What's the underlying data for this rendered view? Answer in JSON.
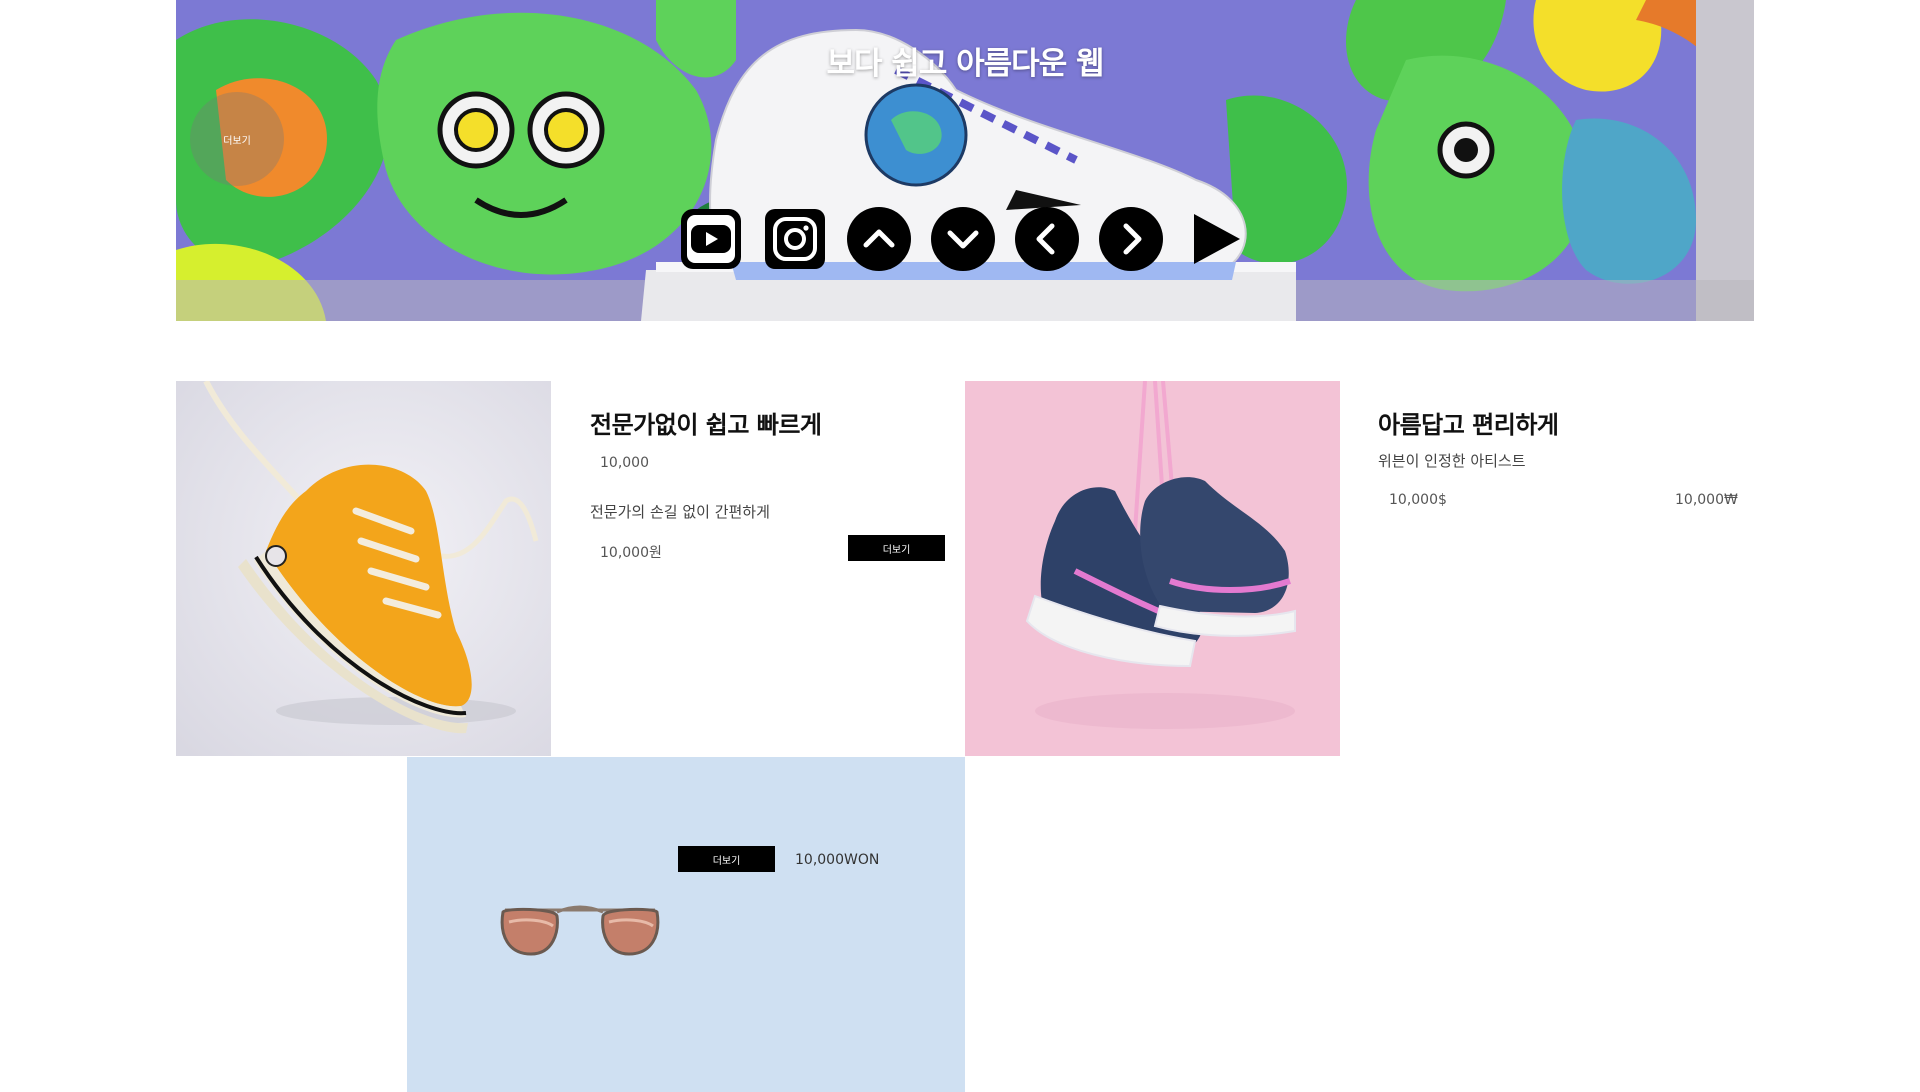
{
  "hero": {
    "title": "보다 쉽고 아름다운 웹",
    "more_label": "더보기",
    "icons": [
      "youtube-icon",
      "instagram-icon",
      "chevron-up-icon",
      "chevron-down-icon",
      "chevron-left-icon",
      "chevron-right-icon",
      "play-icon"
    ]
  },
  "card1": {
    "title": "전문가없이 쉽고 빠르게",
    "price_top": "10,000",
    "subtitle": "전문가의 손길 없이 간편하게",
    "price_bottom": "10,000원",
    "button": "더보기"
  },
  "card2": {
    "title": "아름답고 편리하게",
    "subtitle": "위븐이 인정한 아티스트",
    "price_left": "10,000$",
    "price_right": "10,000₩"
  },
  "promo": {
    "button": "더보기",
    "price": "10,000WON"
  },
  "colors": {
    "hero_bg": "#8a86d8",
    "accent_black": "#000000",
    "card_yellow_bg": "#e4e3ec",
    "card_pink_bg": "#f3c3d6",
    "promo_bg": "#cfe0f2"
  }
}
